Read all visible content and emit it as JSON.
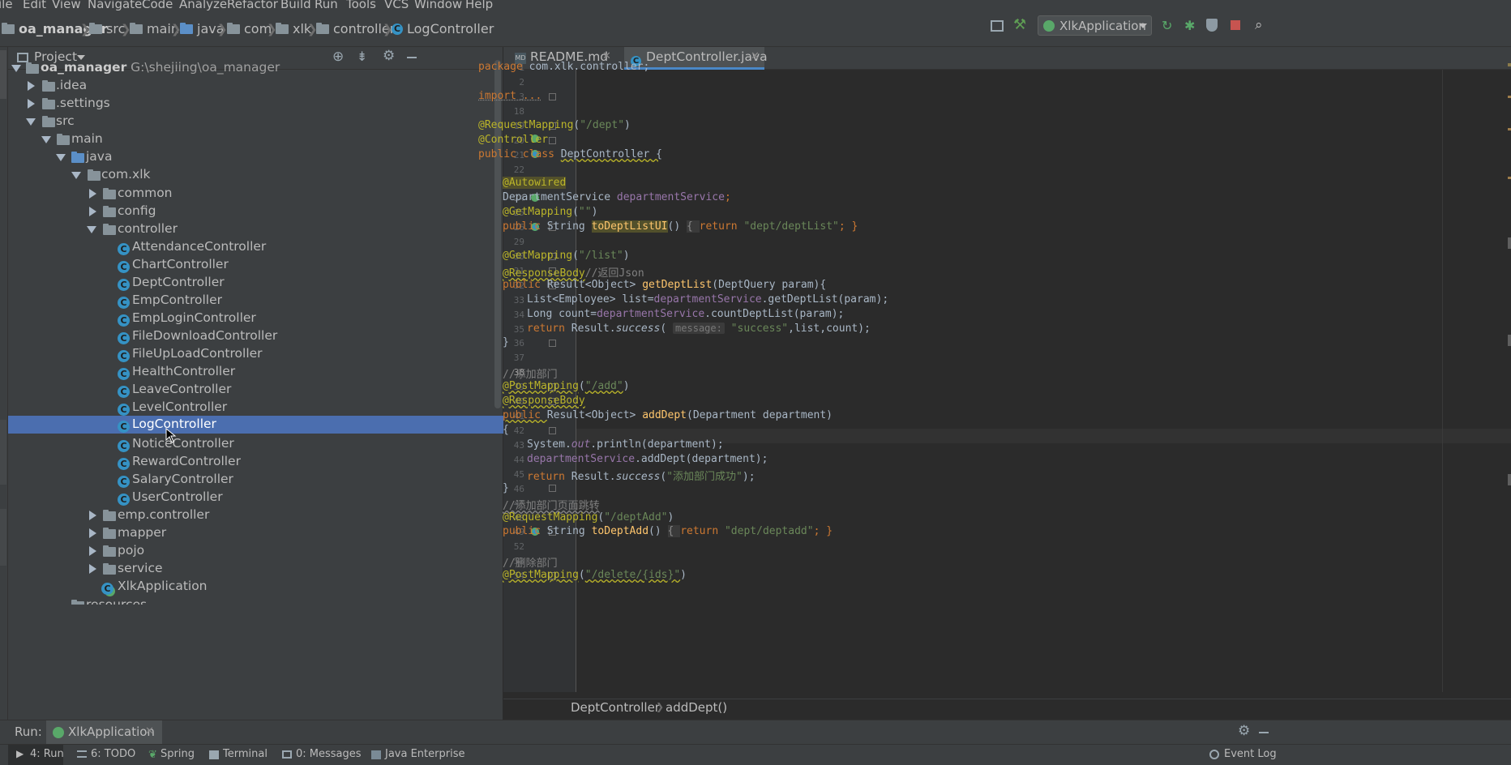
{
  "menu": [
    "ile",
    "Edit",
    "View",
    "Navigate",
    "Code",
    "Analyze",
    "Refactor",
    "Build",
    "Run",
    "Tools",
    "VCS",
    "Window",
    "Help"
  ],
  "breadcrumb": {
    "project": "oa_manager",
    "items": [
      "src",
      "main",
      "java",
      "com",
      "xlk",
      "controller",
      "LogController"
    ]
  },
  "run_config": "XlkApplication",
  "project_panel": {
    "title": "Project",
    "root_name": "oa_manager",
    "root_path": "G:\\shejiing\\oa_manager"
  },
  "tree": {
    "idea": ".idea",
    "settings": ".settings",
    "src": "src",
    "main": "main",
    "java": "java",
    "pkg": "com.xlk",
    "common": "common",
    "config": "config",
    "controller": "controller",
    "controllers": [
      "AttendanceController",
      "ChartController",
      "DeptController",
      "EmpController",
      "EmpLoginController",
      "FileDownloadController",
      "FileUpLoadController",
      "HealthController",
      "LeaveController",
      "LevelController",
      "LogController",
      "NoticeController",
      "RewardController",
      "SalaryController",
      "UserController"
    ],
    "emp_controller": "emp.controller",
    "mapper": "mapper",
    "pojo": "pojo",
    "service": "service",
    "app": "XlkApplication",
    "resources": "resources"
  },
  "tabs": [
    {
      "label": "README.md",
      "active": false
    },
    {
      "label": "DeptController.java",
      "active": true
    }
  ],
  "line_numbers": [
    "1",
    "2",
    "3",
    "18",
    "19",
    "20",
    "21",
    "22",
    "23",
    "24",
    "25",
    "26",
    "29",
    "30",
    "31",
    "32",
    "33",
    "34",
    "35",
    "36",
    "37",
    "38",
    "39",
    "40",
    "41",
    "42",
    "43",
    "44",
    "45",
    "46",
    "47",
    "48",
    "49",
    "52",
    "53",
    "54"
  ],
  "code": {
    "l1_a": "package ",
    "l1_b": "com.xlk.controller;",
    "l3": "import ...",
    "l19_a": "@RequestMapping",
    "l19_b": "(",
    "l19_c": "\"/dept\"",
    "l19_d": ")",
    "l20": "@Controller",
    "l21_a": "public class ",
    "l21_b": "DeptController {",
    "l23": "@Autowired",
    "l24_a": "DepartmentService ",
    "l24_b": "departmentService",
    "l24_c": ";",
    "l25_a": "@GetMapping",
    "l25_b": "(",
    "l25_c": "\"\"",
    "l25_d": ")",
    "l26_a": "public ",
    "l26_b": "String ",
    "l26_c": "toDeptListUI",
    "l26_d": "() ",
    "l26_e": "{ ",
    "l26_f": "return ",
    "l26_g": "\"dept/deptList\"",
    "l26_h": "; }",
    "l30_a": "@GetMapping",
    "l30_b": "(",
    "l30_c": "\"/list\"",
    "l30_d": ")",
    "l31_a": "@ResponseBody",
    "l31_b": "//返回Json",
    "l32_a": "public ",
    "l32_b": "Result<Object> ",
    "l32_c": "getDeptList",
    "l32_d": "(DeptQuery param){",
    "l33_a": "List<Employee> list=",
    "l33_b": "departmentService",
    "l33_c": ".getDeptList(param);",
    "l34_a": "Long count=",
    "l34_b": "departmentService",
    "l34_c": ".countDeptList(param);",
    "l35_a": "return ",
    "l35_b": "Result.",
    "l35_c": "success",
    "l35_d": "( ",
    "l35_e": "message:",
    "l35_f": " ",
    "l35_g": "\"success\"",
    "l35_h": ",list,count);",
    "l36": "}",
    "l38": "//添加部门",
    "l39_a": "@PostMapping",
    "l39_b": "(",
    "l39_c": "\"/add\"",
    "l39_d": ")",
    "l40": "@ResponseBody",
    "l41_a": "public ",
    "l41_b": "Result<Object> ",
    "l41_c": "addDept",
    "l41_d": "(Department department)",
    "l42": "{",
    "l43_a": "System.",
    "l43_b": "out",
    "l43_c": ".println(department);",
    "l44_a": "departmentService",
    "l44_b": ".addDept(department);",
    "l45_a": "return ",
    "l45_b": "Result.",
    "l45_c": "success",
    "l45_d": "(",
    "l45_e": "\"添加部门成功\"",
    "l45_f": ");",
    "l46": "}",
    "l47": "//添加部门页面跳转",
    "l48_a": "@RequestMapping",
    "l48_b": "(",
    "l48_c": "\"/deptAdd\"",
    "l48_d": ")",
    "l49_a": "public ",
    "l49_b": "String ",
    "l49_c": "toDeptAdd",
    "l49_d": "() ",
    "l49_e": "{ ",
    "l49_f": "return ",
    "l49_g": "\"dept/deptadd\"",
    "l49_h": "; }",
    "l53": "//删除部门",
    "l54_a": "@PostMapping",
    "l54_b": "(",
    "l54_c": "\"/delete/{ids}\"",
    "l54_d": ")"
  },
  "editor_breadcrumb": [
    "DeptController",
    "addDept()"
  ],
  "run": {
    "label": "Run:",
    "config": "XlkApplication"
  },
  "bottom_tools": [
    "4: Run",
    "6: TODO",
    "Spring",
    "Terminal",
    "0: Messages",
    "Java Enterprise"
  ],
  "event_log": "Event Log",
  "colors": {
    "selection": "#4b6eaf",
    "keyword": "#cc7832",
    "annotation": "#bbb529",
    "string": "#6a8759",
    "field": "#9876aa"
  }
}
